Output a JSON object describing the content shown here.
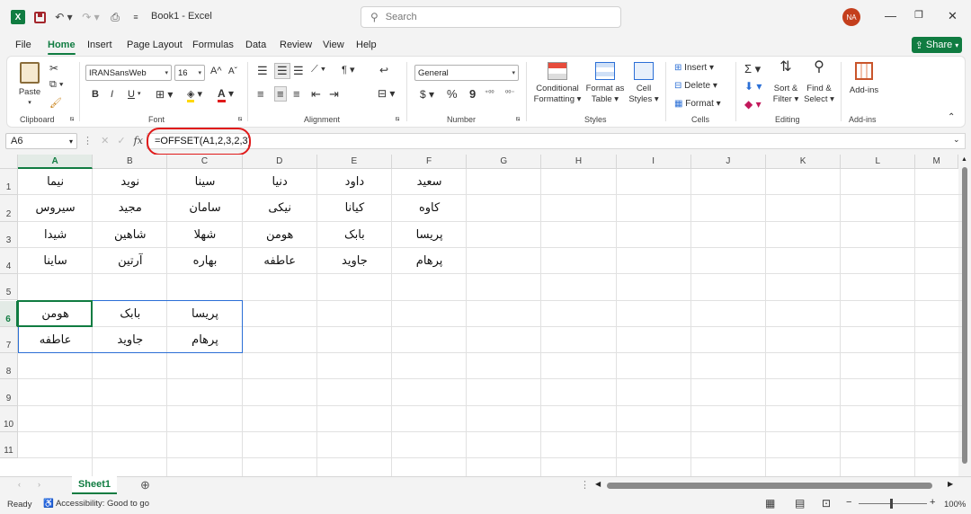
{
  "window": {
    "app_icon": "X",
    "title": "Book1  -  Excel",
    "search_placeholder": "Search",
    "avatar": "NA"
  },
  "menu": [
    "File",
    "Home",
    "Insert",
    "Page Layout",
    "Formulas",
    "Data",
    "Review",
    "View",
    "Help"
  ],
  "share_label": "Share",
  "ribbon": {
    "clipboard": {
      "paste": "Paste",
      "label": "Clipboard"
    },
    "font": {
      "name": "IRANSansWeb",
      "size": "16",
      "bold": "B",
      "italic": "I",
      "underline": "U",
      "grow": "A",
      "shrink": "A",
      "label": "Font"
    },
    "alignment": {
      "label": "Alignment"
    },
    "number": {
      "format": "General",
      "currency": "$",
      "percent": "%",
      "comma": "9",
      "label": "Number"
    },
    "styles": {
      "conditional": "Conditional",
      "conditional2": "Formatting",
      "format_as": "Format as",
      "format_as2": "Table",
      "cell": "Cell",
      "cell2": "Styles",
      "label": "Styles"
    },
    "cells": {
      "insert": "Insert",
      "delete": "Delete",
      "format": "Format",
      "label": "Cells"
    },
    "editing": {
      "sort": "Sort &",
      "sort2": "Filter",
      "find": "Find &",
      "find2": "Select",
      "label": "Editing"
    },
    "addins": {
      "btn": "Add-ins",
      "label": "Add-ins"
    }
  },
  "formula_bar": {
    "name_box": "A6",
    "fx": "fx",
    "formula": "=OFFSET(A1,2,3,2,3)"
  },
  "columns": [
    "A",
    "B",
    "C",
    "D",
    "E",
    "F",
    "G",
    "H",
    "I",
    "J",
    "K",
    "L",
    "M"
  ],
  "rows": [
    "1",
    "2",
    "3",
    "4",
    "5",
    "6",
    "7",
    "8",
    "9",
    "10",
    "11"
  ],
  "cells": {
    "r1": [
      "نیما",
      "نوید",
      "سینا",
      "دنیا",
      "داود",
      "سعید"
    ],
    "r2": [
      "سیروس",
      "مجید",
      "سامان",
      "نیکی",
      "کیانا",
      "کاوه"
    ],
    "r3": [
      "شیدا",
      "شاهین",
      "شهلا",
      "هومن",
      "بابک",
      "پریسا"
    ],
    "r4": [
      "ساینا",
      "آرتین",
      "بهاره",
      "عاطفه",
      "جاوید",
      "پرهام"
    ],
    "r6": [
      "هومن",
      "بابک",
      "پریسا"
    ],
    "r7": [
      "عاطفه",
      "جاوید",
      "پرهام"
    ]
  },
  "sheet_tab": "Sheet1",
  "status": {
    "ready": "Ready",
    "accessibility": "Accessibility: Good to go",
    "zoom": "100%"
  }
}
